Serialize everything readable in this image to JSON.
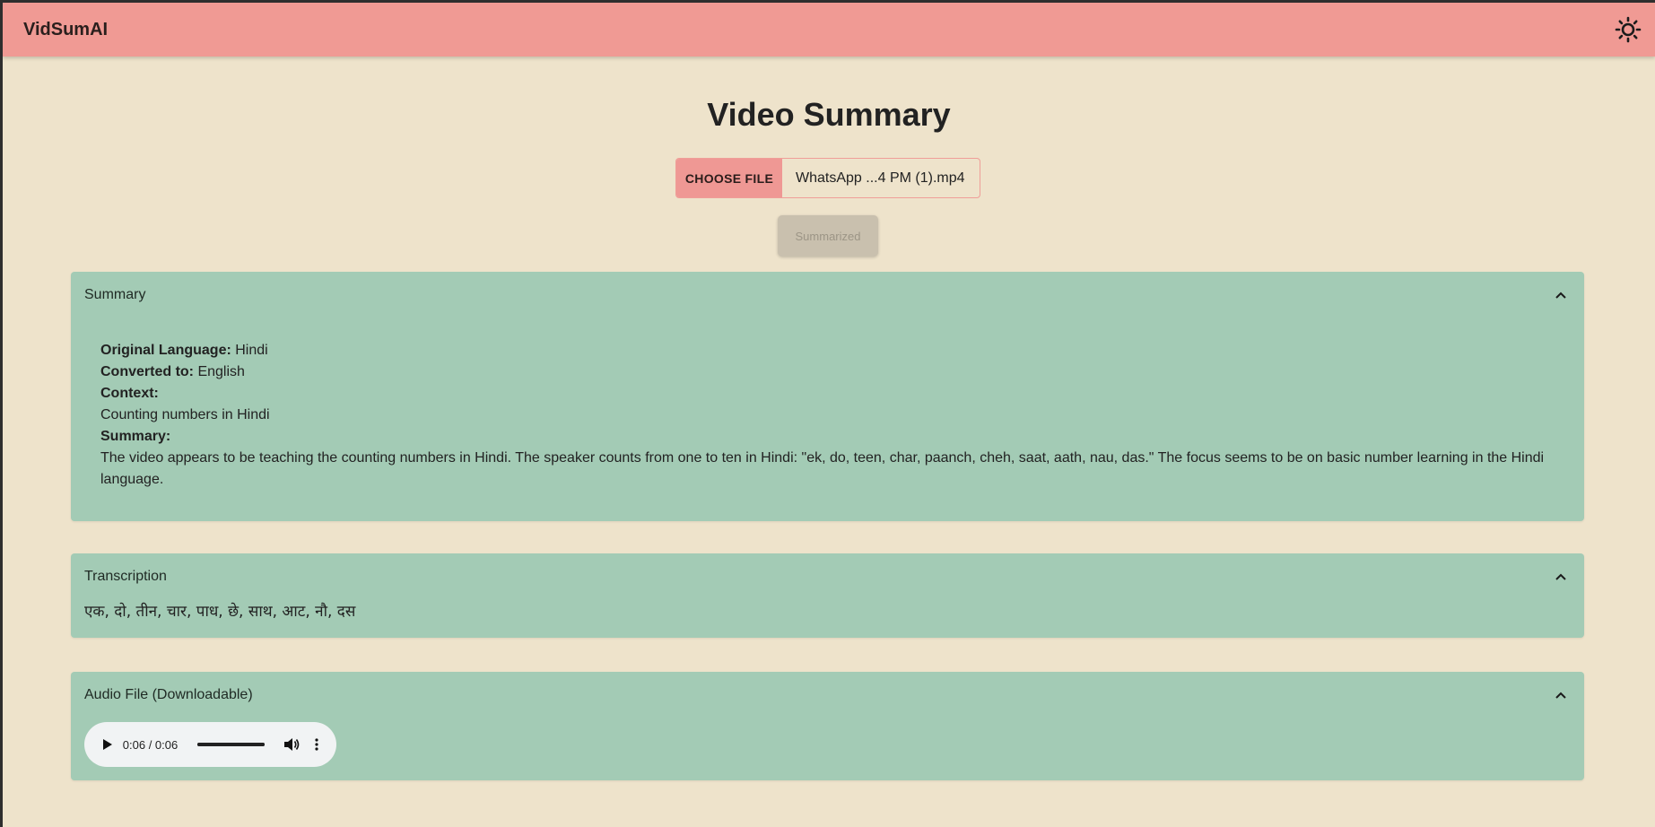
{
  "app": {
    "name": "VidSumAI",
    "theme_icon": "sun-icon"
  },
  "colors": {
    "appbar": "#f09a94",
    "background": "#eee3cb",
    "panel": "#a3cbb5",
    "accent_button": "#ef9894"
  },
  "page": {
    "title": "Video Summary"
  },
  "upload": {
    "choose_label": "CHOOSE FILE",
    "file_name": "WhatsApp ...4 PM (1).mp4",
    "submit_label": "Summarized",
    "submit_disabled": true
  },
  "summary_panel": {
    "title": "Summary",
    "expanded": true,
    "original_language_label": "Original Language:",
    "original_language_value": "Hindi",
    "converted_label": "Converted to:",
    "converted_value": "English",
    "context_label": "Context:",
    "context_value": "Counting numbers in Hindi",
    "summary_label": "Summary:",
    "summary_value": "The video appears to be teaching the counting numbers in Hindi. The speaker counts from one to ten in Hindi: \"ek, do, teen, char, paanch, cheh, saat, aath, nau, das.\" The focus seems to be on basic number learning in the Hindi language."
  },
  "transcription_panel": {
    "title": "Transcription",
    "expanded": true,
    "text": "एक, दो, तीन, चार, पाध, छे, साथ, आट, नौ, दस"
  },
  "audio_panel": {
    "title": "Audio File (Downloadable)",
    "expanded": true,
    "player": {
      "time": "0:06 / 0:06",
      "progress": 1.0
    }
  }
}
